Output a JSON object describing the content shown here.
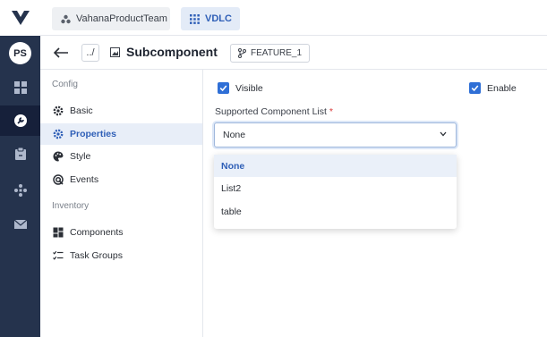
{
  "topbar": {
    "team_label": "VahanaProductTeam",
    "app_label": "VDLC"
  },
  "rail": {
    "avatar_initials": "PS",
    "items": [
      {
        "icon": "dashboard-icon"
      },
      {
        "icon": "wrench-icon",
        "active": true
      },
      {
        "icon": "clipboard-icon"
      },
      {
        "icon": "network-icon"
      },
      {
        "icon": "mail-icon"
      }
    ]
  },
  "header": {
    "breadcrumb": "../",
    "title": "Subcomponent",
    "branch": "FEATURE_1"
  },
  "side": {
    "config_heading": "Config",
    "inventory_heading": "Inventory",
    "items": [
      {
        "label": "Basic",
        "icon": "gear-icon"
      },
      {
        "label": "Properties",
        "icon": "gear-icon",
        "active": true
      },
      {
        "label": "Style",
        "icon": "palette-icon"
      },
      {
        "label": "Events",
        "icon": "events-icon"
      },
      {
        "label": "Components",
        "icon": "components-icon"
      },
      {
        "label": "Task Groups",
        "icon": "task-list-icon"
      }
    ]
  },
  "form": {
    "visible_label": "Visible",
    "visible_checked": true,
    "enable_label": "Enable",
    "enable_checked": true,
    "supported_label": "Supported Component List",
    "required_mark": "*",
    "selected_value": "None",
    "options": [
      "None",
      "List2",
      "table"
    ]
  },
  "colors": {
    "rail": "#25334d",
    "accent": "#2f6fd6",
    "active_bg": "#e8eef8"
  }
}
